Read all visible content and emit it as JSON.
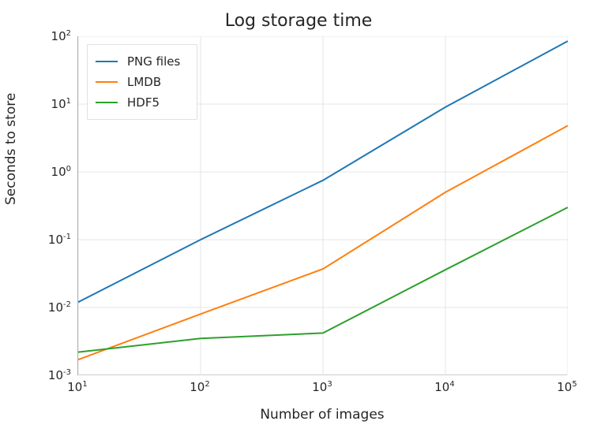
{
  "chart_data": {
    "type": "line",
    "title": "Log storage time",
    "xlabel": "Number of images",
    "ylabel": "Seconds to store",
    "xscale": "log",
    "yscale": "log",
    "xlim": [
      10,
      100000
    ],
    "ylim": [
      0.001,
      100
    ],
    "x": [
      10,
      100,
      1000,
      10000,
      100000
    ],
    "xtick_labels": [
      "10^1",
      "10^2",
      "10^3",
      "10^4",
      "10^5"
    ],
    "ytick_values": [
      0.001,
      0.01,
      0.1,
      1,
      10,
      100
    ],
    "ytick_labels": [
      "10^-3",
      "10^-2",
      "10^-1",
      "10^0",
      "10^1",
      "10^2"
    ],
    "series": [
      {
        "name": "PNG files",
        "color": "#1f77b4",
        "values": [
          0.012,
          0.1,
          0.75,
          9.0,
          85.0
        ]
      },
      {
        "name": "LMDB",
        "color": "#ff7f0e",
        "values": [
          0.0017,
          0.008,
          0.037,
          0.5,
          4.8
        ]
      },
      {
        "name": "HDF5",
        "color": "#2ca02c",
        "values": [
          0.0022,
          0.0035,
          0.0042,
          0.036,
          0.3
        ]
      }
    ],
    "legend_position": "upper left",
    "grid": true
  }
}
